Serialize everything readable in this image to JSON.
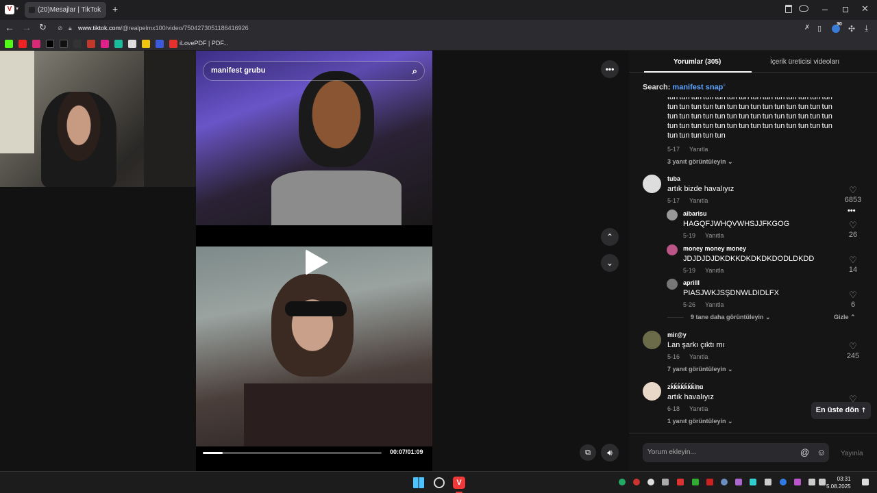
{
  "browser": {
    "tab_title": "(20)Mesajlar | TikTok",
    "url_host": "www.tiktok.com",
    "url_path": "/@realpelmx100/video/7504273051186416926",
    "extension_badge": "30",
    "bookmark_label": "iLovePDF | PDF..."
  },
  "video": {
    "search_text": "manifest grubu",
    "progress_fraction": 0.11,
    "timecode": "00:07/01:09"
  },
  "panel": {
    "tab_comments": "Yorumlar (305)",
    "tab_creator": "İçerik üreticisi videoları",
    "search_prefix": "Search:",
    "search_term": "manifest snap",
    "comment_input_placeholder": "Yorum ekleyin...",
    "publish_label": "Yayınla",
    "back_to_top": "En üste dön"
  },
  "comments": {
    "first_text": "tun tun tun tun tun tun tun tun tun tun tun tun tun tun tun tun tun tun tun tun tun tun tun tun tun tun tun tun tun tun tun tun tun tun tun tun tun tun tun tun tun tun tun tun tun tun tun tun tun tun tun tun tun tun tun tun tun tun tun tun tun",
    "first_date": "5-17",
    "first_replies": "3 yanıt görüntüleyin",
    "reply_label": "Yanıtla",
    "c1_user": "tuba",
    "c1_text": "artık bizde havalıyız",
    "c1_date": "5-17",
    "c1_likes": "6853",
    "r1_user": "aibarisu",
    "r1_text": "HAGQFJWHQVWHSJJFKGOG",
    "r1_date": "5-19",
    "r1_likes": "26",
    "r2_user": "money money money",
    "r2_text": "JDJDJDJDKDKKDKDKDKDODLDKDD",
    "r2_date": "5-19",
    "r2_likes": "14",
    "r3_user": "aprilll",
    "r3_text": "PIASJWKJSŞDNWLDIDLFX",
    "r3_date": "5-26",
    "r3_likes": "6",
    "more_replies": "9 tane daha görüntüleyin",
    "hide_label": "Gizle",
    "c2_user": "mir@y",
    "c2_text": "Lan şarkı çıktı mı",
    "c2_date": "5-16",
    "c2_likes": "245",
    "c2_replies": "7 yanıt görüntüleyin",
    "c3_user": "zǩǩǩǩǩǩǩiᥒɑ",
    "c3_text": "artık havalıyız",
    "c3_date": "6-18",
    "c3_replies": "1 yanıt görüntüleyin"
  },
  "taskbar": {
    "time": "03:31",
    "date": "5.08.2025"
  },
  "colors": {
    "accent_blue": "#5ea3ff",
    "vivaldi_red": "#ef3939",
    "panel_bg": "#151515"
  }
}
